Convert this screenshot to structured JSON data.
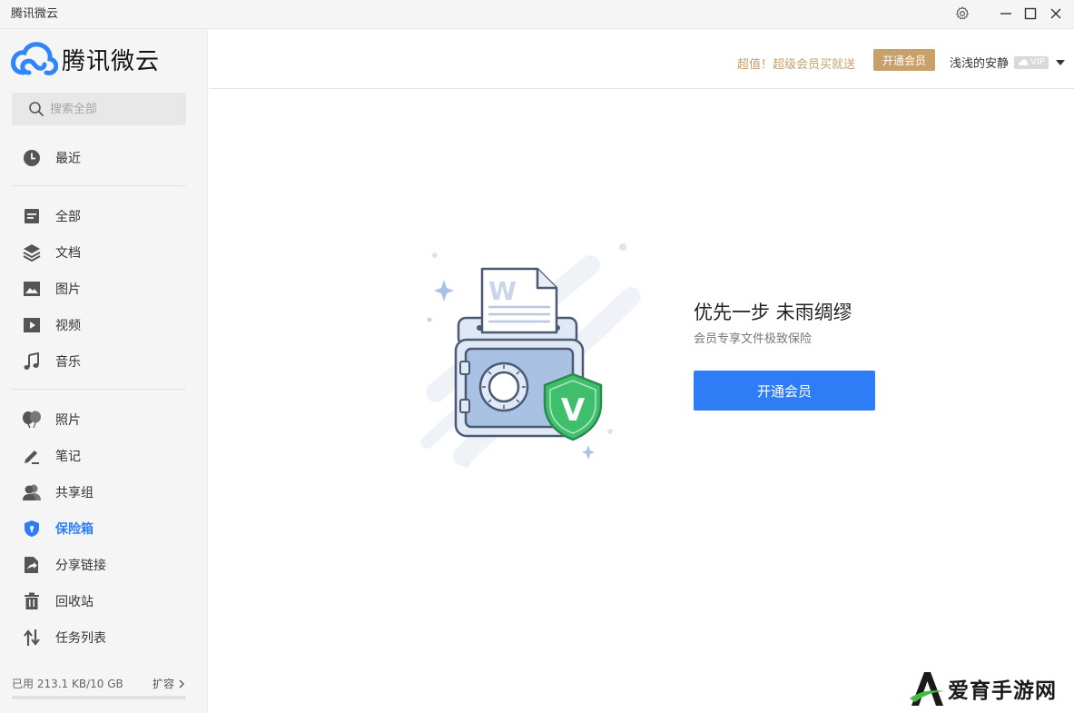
{
  "window": {
    "title": "腾讯微云"
  },
  "sidebar": {
    "logo_text": "腾讯微云",
    "search_placeholder": "搜索全部",
    "recent": {
      "label": "最近",
      "icon": "clock-icon"
    },
    "groups": [
      {
        "label": "全部",
        "icon": "all-files-icon"
      },
      {
        "label": "文档",
        "icon": "layers-icon"
      },
      {
        "label": "图片",
        "icon": "image-icon"
      },
      {
        "label": "视频",
        "icon": "video-icon"
      },
      {
        "label": "音乐",
        "icon": "music-icon"
      }
    ],
    "tools": [
      {
        "label": "照片",
        "icon": "photo-balloon-icon"
      },
      {
        "label": "笔记",
        "icon": "pen-icon"
      },
      {
        "label": "共享组",
        "icon": "group-icon"
      },
      {
        "label": "保险箱",
        "icon": "shield-icon",
        "active": true
      },
      {
        "label": "分享链接",
        "icon": "share-link-icon"
      },
      {
        "label": "回收站",
        "icon": "trash-icon"
      },
      {
        "label": "任务列表",
        "icon": "transfer-icon"
      }
    ],
    "storage": {
      "text": "已用 213.1 KB/10 GB",
      "expand_label": "扩容",
      "used_fraction": 2e-05
    }
  },
  "header": {
    "promo_text": "超值！超级会员买就送",
    "join_label": "开通会员",
    "username": "浅浅的安静",
    "vip_badge": "VIP"
  },
  "main": {
    "title": "优先一步 未雨绸缪",
    "subtitle": "会员专享文件极致保险",
    "cta_label": "开通会员",
    "illustration_letters": {
      "doc": "W",
      "shield": "V"
    }
  },
  "watermark": {
    "text": "爱育手游网"
  },
  "colors": {
    "accent": "#2f7df6",
    "gold": "#c7a06a",
    "sidebar_bg": "#f5f5f5",
    "shield_green": "#3fbf6b"
  }
}
